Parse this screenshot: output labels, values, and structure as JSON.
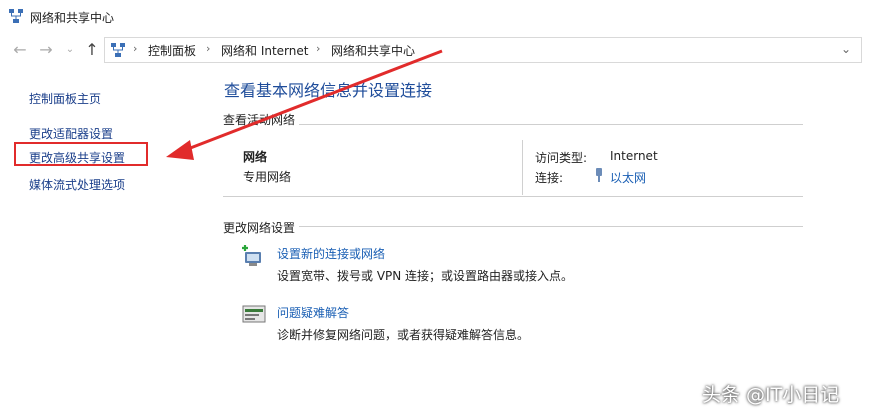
{
  "window": {
    "title": "网络和共享中心"
  },
  "breadcrumb": {
    "items": [
      "控制面板",
      "网络和 Internet",
      "网络和共享中心"
    ]
  },
  "sidebar": {
    "items": [
      {
        "label": "控制面板主页"
      },
      {
        "label": "更改适配器设置"
      },
      {
        "label": "更改高级共享设置"
      },
      {
        "label": "媒体流式处理选项"
      }
    ]
  },
  "main": {
    "title": "查看基本网络信息并设置连接",
    "active_section_label": "查看活动网络",
    "network": {
      "name": "网络",
      "profile": "专用网络",
      "access_type_label": "访问类型:",
      "access_type_value": "Internet",
      "connection_label": "连接:",
      "connection_value": "以太网"
    },
    "settings_section_label": "更改网络设置",
    "tasks": [
      {
        "link": "设置新的连接或网络",
        "desc": "设置宽带、拨号或 VPN 连接；或设置路由器或接入点。"
      },
      {
        "link": "问题疑难解答",
        "desc": "诊断并修复网络问题，或者获得疑难解答信息。"
      }
    ]
  },
  "watermark": "头条 @IT小日记",
  "colors": {
    "link": "#1a5fb4",
    "title": "#1e4c9a",
    "annotation": "#e12b2b"
  }
}
